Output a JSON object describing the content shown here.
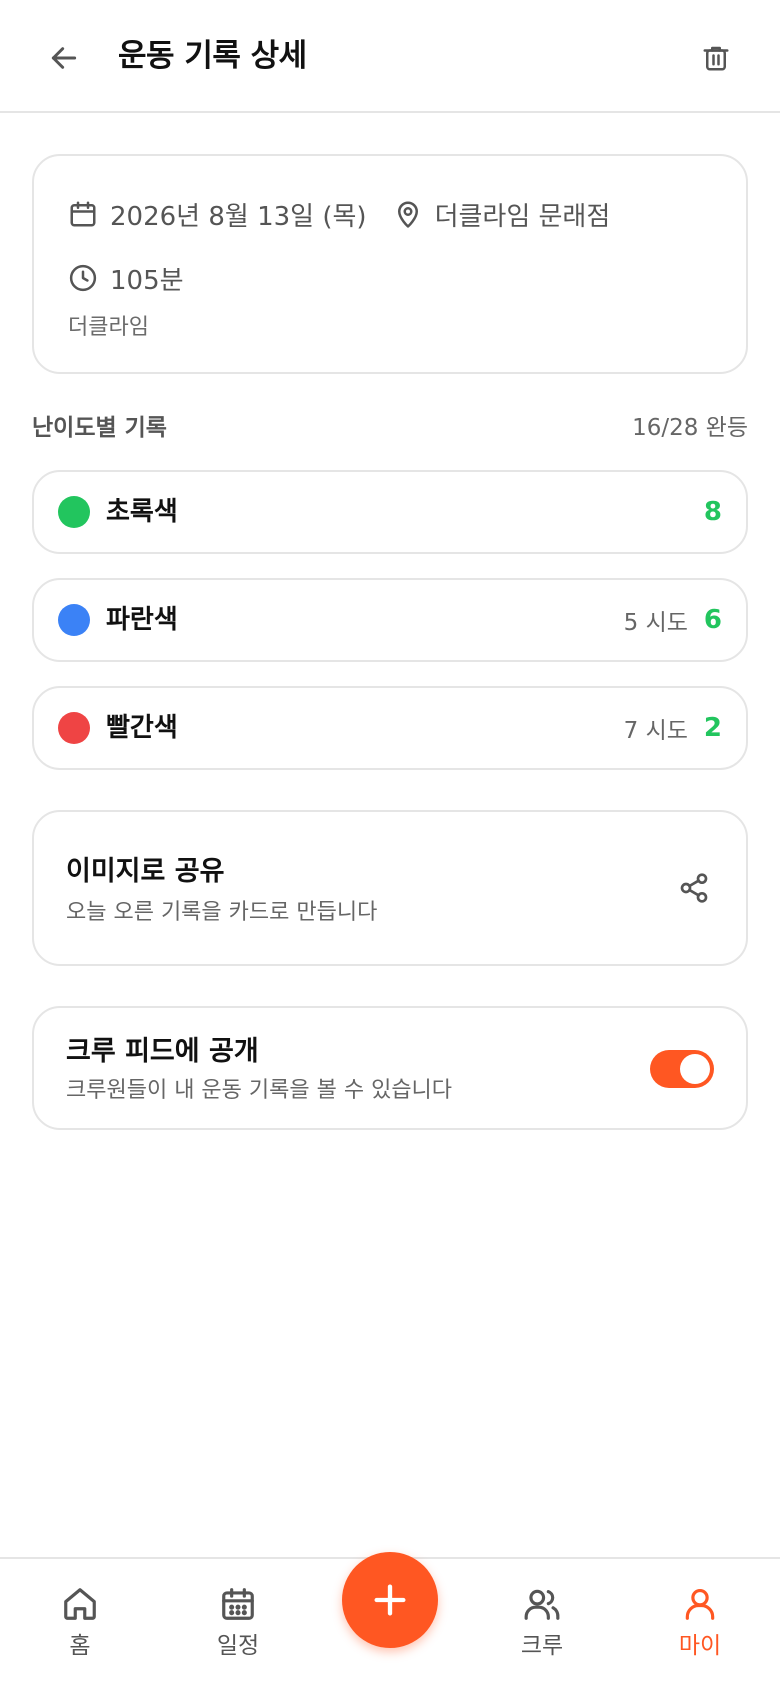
{
  "header": {
    "title": "운동 기록 상세"
  },
  "info": {
    "date": "2026년 8월 13일 (목)",
    "location": "더클라임 문래점",
    "duration": "105분",
    "gym": "더클라임"
  },
  "difficulty_section": {
    "title": "난이도별 기록",
    "summary": "16/28 완등",
    "items": [
      {
        "label": "초록색",
        "color": "#22c55e",
        "attempts": "",
        "count": "8"
      },
      {
        "label": "파란색",
        "color": "#3b82f6",
        "attempts": "5 시도",
        "count": "6"
      },
      {
        "label": "빨간색",
        "color": "#ef4444",
        "attempts": "7 시도",
        "count": "2"
      }
    ]
  },
  "share": {
    "title": "이미지로 공유",
    "subtitle": "오늘 오른 기록을 카드로 만듭니다"
  },
  "crew_feed": {
    "title": "크루 피드에 공개",
    "subtitle": "크루원들이 내 운동 기록을 볼 수 있습니다",
    "enabled": true
  },
  "nav": {
    "items": [
      {
        "label": "홈",
        "icon": "home-icon"
      },
      {
        "label": "일정",
        "icon": "calendar-icon"
      },
      {
        "label": "크루",
        "icon": "users-icon"
      },
      {
        "label": "마이",
        "icon": "user-icon"
      }
    ],
    "active": "마이"
  },
  "colors": {
    "accent": "#ff5722",
    "success": "#22c55e"
  }
}
